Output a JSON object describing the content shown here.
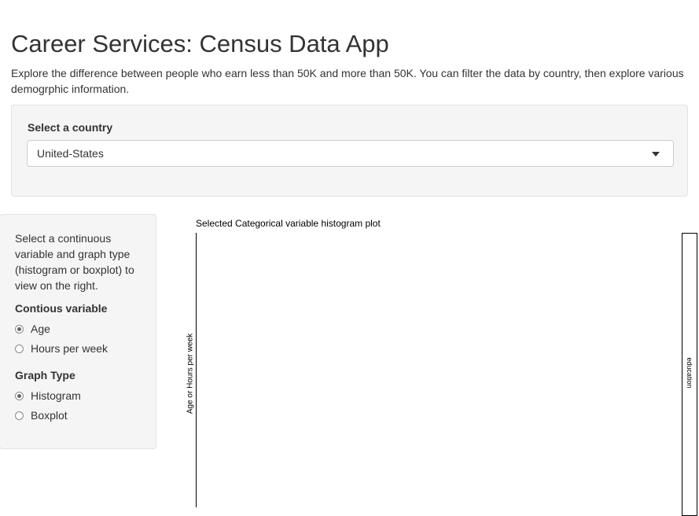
{
  "header": {
    "title": "Career Services: Census Data App",
    "description": "Explore the difference between people who earn less than 50K and more than 50K. You can filter the data by country, then explore various demogrphic information."
  },
  "country_filter": {
    "label": "Select a country",
    "selected": "United-States"
  },
  "sidebar": {
    "help_text": "Select a continuous variable and graph type (histogram or boxplot) to view on the right.",
    "continuous_variable": {
      "label": "Contious variable",
      "options": [
        {
          "label": "Age",
          "checked": true
        },
        {
          "label": "Hours per week",
          "checked": false
        }
      ]
    },
    "graph_type": {
      "label": "Graph Type",
      "options": [
        {
          "label": "Histogram",
          "checked": true
        },
        {
          "label": "Boxplot",
          "checked": false
        }
      ]
    }
  },
  "plot": {
    "title": "Selected Categorical variable histogram plot",
    "y_axis_label": "Age or Hours per week",
    "facet_strip_label": "education"
  },
  "colors": {
    "well_background": "#f5f5f5",
    "well_border": "#e3e3e3",
    "text": "#333333"
  }
}
